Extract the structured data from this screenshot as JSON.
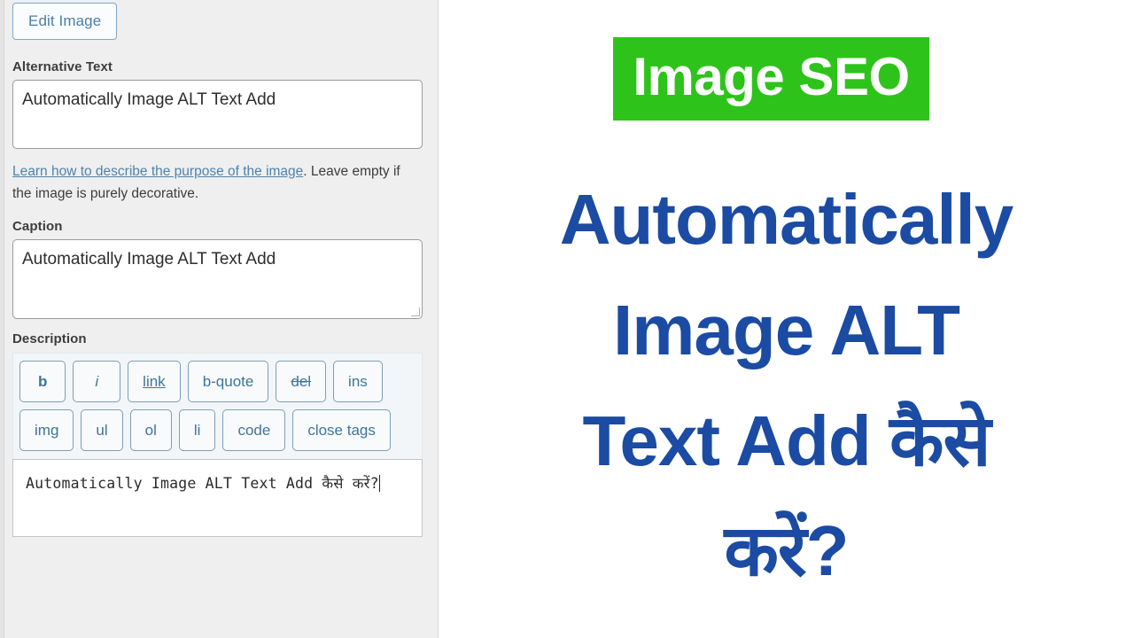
{
  "left_panel": {
    "edit_image_button": "Edit Image",
    "alt_text": {
      "label": "Alternative Text",
      "value": "Automatically Image ALT Text Add"
    },
    "help": {
      "link_text": "Learn how to describe the purpose of the image",
      "rest_text": ". Leave empty if the image is purely decorative."
    },
    "caption": {
      "label": "Caption",
      "value": "Automatically Image ALT Text Add"
    },
    "description": {
      "label": "Description",
      "toolbar_buttons": [
        "b",
        "i",
        "link",
        "b-quote",
        "del",
        "ins",
        "img",
        "ul",
        "ol",
        "li",
        "code",
        "close tags"
      ],
      "editor_value": "Automatically Image ALT Text Add कैसे करें?"
    }
  },
  "promo": {
    "badge_text": "Image SEO",
    "badge_color": "#2ec31a",
    "title_color": "#1b4ba3",
    "title_lines": [
      "Automatically",
      "Image ALT",
      "Text Add कैसे",
      "करें?"
    ]
  }
}
